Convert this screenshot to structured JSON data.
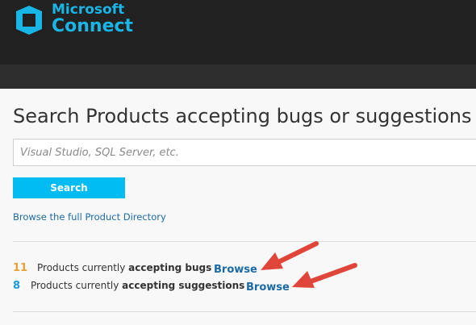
{
  "header": {
    "logo_line1": "Microsoft",
    "logo_line2": "Connect",
    "brand_color": "#18b5e7",
    "background_color": "#212121"
  },
  "main": {
    "title": "Search Products accepting bugs or suggestions",
    "search": {
      "value": "",
      "placeholder": "Visual Studio, SQL Server, etc."
    },
    "search_button_label": "Search",
    "search_button_color": "#00bcf2",
    "directory_link": "Browse the full Product Directory",
    "stats": [
      {
        "count": "11",
        "text_prefix": "Products currently ",
        "text_bold": "accepting bugs",
        "action": "Browse",
        "count_color": "#e8a033"
      },
      {
        "count": "8",
        "text_prefix": "Products currently ",
        "text_bold": "accepting suggestions",
        "action": "Browse",
        "count_color": "#1e9ad8"
      }
    ],
    "annotation_arrow_color": "#e0453a"
  }
}
